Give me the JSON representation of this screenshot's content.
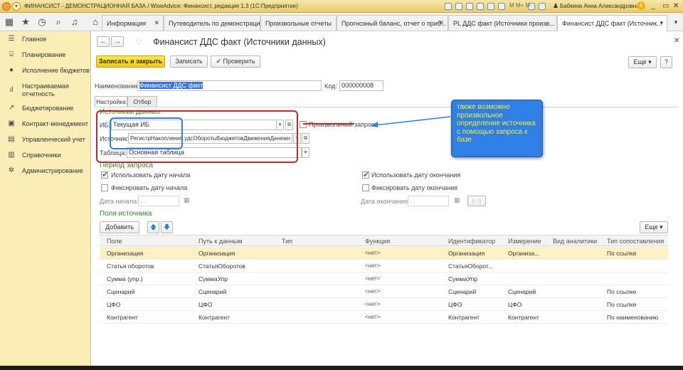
{
  "titlebar": {
    "text": "ФИНАНСИСТ - ДЕМОНСТРАЦИОННАЯ БАЗА / WiseAdvice: Финансист, редакция 1.3  (1С:Предприятие)",
    "user": "Бабкина Анна Александровна",
    "window_controls": [
      "_",
      "▭",
      "✕"
    ]
  },
  "nav_icons": [
    "grid-icon",
    "star-icon",
    "history-icon",
    "search-icon",
    "bell-icon",
    "home-icon"
  ],
  "tabs": [
    {
      "label": "Информация",
      "active": false
    },
    {
      "label": "Путеводитель по демонстрацион...",
      "active": false
    },
    {
      "label": "Произвольные отчеты",
      "active": false
    },
    {
      "label": "Прогнозный баланс, отчет о приб...",
      "active": false
    },
    {
      "label": "PL ДДС факт (Источники произв...",
      "active": false
    },
    {
      "label": "Финансист ДДС факт (Источник...",
      "active": true
    }
  ],
  "sidebar": {
    "items": [
      {
        "label": "Главное",
        "icon": "list-icon"
      },
      {
        "label": "Планирование",
        "icon": "chart-icon"
      },
      {
        "label": "Исполнение бюджетов",
        "icon": "coin-icon"
      },
      {
        "label": "Настраиваемая отчетность",
        "icon": "bars-icon"
      },
      {
        "label": "Бюджетирование",
        "icon": "trend-icon"
      },
      {
        "label": "Контракт-менеджмент",
        "icon": "book-icon"
      },
      {
        "label": "Управленческий учет",
        "icon": "ledger-icon"
      },
      {
        "label": "Справочники",
        "icon": "folder-icon"
      },
      {
        "label": "Администрирование",
        "icon": "gear-icon"
      }
    ]
  },
  "form": {
    "title": "Финансист ДДС факт (Источники данных)",
    "buttons": {
      "save_close": "Записать и закрыть",
      "save": "Записать",
      "check": "Проверить",
      "more": "Еще",
      "help": "?"
    },
    "name_label": "Наименование:",
    "name_value": "Финансист ДДС факт",
    "code_label": "Код:",
    "code_value": "000000008",
    "subtabs": [
      "Настройка",
      "Отбор"
    ],
    "sources": {
      "title": "Источники данных",
      "ib_label": "ИБ:",
      "ib_value": "Текущая ИБ",
      "custom_query_label": "Произвольный запрос",
      "source_label": "Источник:",
      "source_value": "РегистрНакопления.удсОборотыБюджетовДвиженияДенежн",
      "table_label": "Таблица:",
      "table_value": "Основная таблица"
    },
    "period": {
      "title": "Период запроса",
      "use_start": "Использовать дату начала",
      "fix_start": "Фиксировать дату начала",
      "start_label": "Дата начала:",
      "start_value": " .  .",
      "use_end": "Использовать дату окончания",
      "fix_end": "Фиксировать дату окончания",
      "end_label": "Дата окончания:",
      "end_value": " .  .",
      "range_btn": "(···)"
    },
    "fields": {
      "title": "Поля источника",
      "add": "Добавить",
      "more": "Еще",
      "columns": [
        "Поле",
        "Путь к данным",
        "Тип",
        "Функция",
        "Идентификатор",
        "Измерение",
        "Вид аналитики",
        "Тип сопоставления"
      ],
      "rows": [
        [
          "Организация",
          "Организация",
          "",
          "<нет>",
          "Организация",
          "Организа...",
          "",
          "По ссылке"
        ],
        [
          "Статья оборотов",
          "СтатьяОборотов",
          "",
          "<нет>",
          "СтатьяОборот...",
          "",
          "",
          ""
        ],
        [
          "Сумма (упр.)",
          "СуммаУпр",
          "",
          "<нет>",
          "СуммаУпр",
          "",
          "",
          ""
        ],
        [
          "Сценарий",
          "Сценарий",
          "",
          "<нет>",
          "Сценарий",
          "Сценарий",
          "",
          "По ссылке"
        ],
        [
          "ЦФО",
          "ЦФО",
          "",
          "<нет>",
          "ЦФО",
          "ЦФО",
          "",
          "По ссылке"
        ],
        [
          "Контрагент",
          "Контрагент",
          "",
          "<нет>",
          "Контрагент",
          "Контрагент",
          "",
          "По наименованию"
        ]
      ]
    }
  },
  "annotation": {
    "text": "также возможно произвольное определение источника с помощью запроса к базе"
  },
  "colors": {
    "sidebar": "#fbedb6",
    "accent_green": "#2b8a2b",
    "annotation_bg": "#2f7fe6",
    "annotation_text": "#f5ef2a",
    "highlight_red": "#c0262a",
    "highlight_blue": "#2f7fe6"
  }
}
